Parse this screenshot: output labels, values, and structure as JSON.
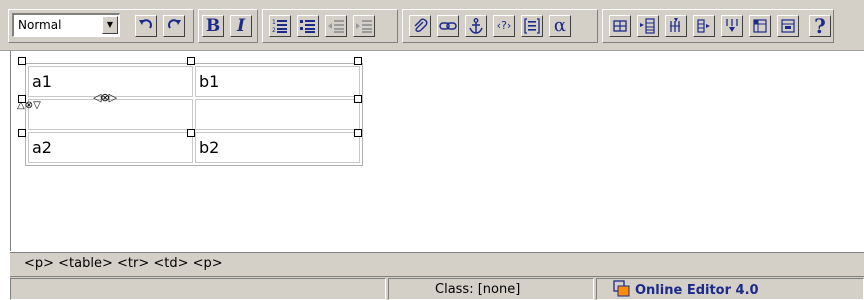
{
  "toolbar": {
    "format_select": {
      "value": "Normal"
    },
    "colors": {
      "face": "#d4d0c8",
      "icon_blue": "#1c2a8a",
      "disabled": "#9a9a9a"
    },
    "buttons": [
      {
        "name": "undo",
        "icon": "undo-arrow-icon",
        "enabled": true
      },
      {
        "name": "redo",
        "icon": "redo-arrow-icon",
        "enabled": true
      },
      {
        "name": "bold",
        "label": "B",
        "enabled": true
      },
      {
        "name": "italic",
        "label": "I",
        "enabled": true
      },
      {
        "name": "ordered-list",
        "icon": "numbered-list-icon",
        "enabled": true
      },
      {
        "name": "unordered-list",
        "icon": "bullet-list-icon",
        "enabled": true
      },
      {
        "name": "outdent",
        "icon": "outdent-icon",
        "enabled": false
      },
      {
        "name": "indent",
        "icon": "indent-icon",
        "enabled": false
      },
      {
        "name": "attach",
        "icon": "paperclip-icon",
        "enabled": true
      },
      {
        "name": "link",
        "icon": "chain-link-icon",
        "enabled": true
      },
      {
        "name": "anchor",
        "icon": "anchor-icon",
        "enabled": true
      },
      {
        "name": "code",
        "label": "‹?›",
        "enabled": true
      },
      {
        "name": "align-box",
        "icon": "bracket-text-icon",
        "enabled": true
      },
      {
        "name": "special-char",
        "label": "α",
        "enabled": true
      },
      {
        "name": "insert-table",
        "icon": "table-icon",
        "enabled": true
      },
      {
        "name": "insert-row",
        "icon": "insert-row-icon",
        "enabled": true
      },
      {
        "name": "insert-col",
        "icon": "insert-column-icon",
        "enabled": true
      },
      {
        "name": "split-cell",
        "icon": "split-cell-icon",
        "enabled": true
      },
      {
        "name": "merge-cell",
        "icon": "merge-cell-icon",
        "enabled": true
      },
      {
        "name": "table-props",
        "icon": "table-properties-icon",
        "enabled": true
      },
      {
        "name": "cell-props",
        "icon": "cell-properties-icon",
        "enabled": true
      },
      {
        "name": "help",
        "label": "?",
        "enabled": true
      }
    ]
  },
  "editor": {
    "table": {
      "rows": [
        [
          "a1",
          "b1"
        ],
        [
          "",
          ""
        ],
        [
          "a2",
          "b2"
        ]
      ]
    },
    "column_resize_glyph": "◁⊗▷",
    "row_resize_glyph": "△⊗▽"
  },
  "path_bar": {
    "text": "<p> <table> <tr> <td> <p>"
  },
  "status_bar": {
    "class_label": "Class: [none]",
    "brand": "Online Editor 4.0",
    "brand_color": "#1c2a8a",
    "logo_colors": [
      "#ff8c00",
      "#1c2a8a"
    ]
  }
}
